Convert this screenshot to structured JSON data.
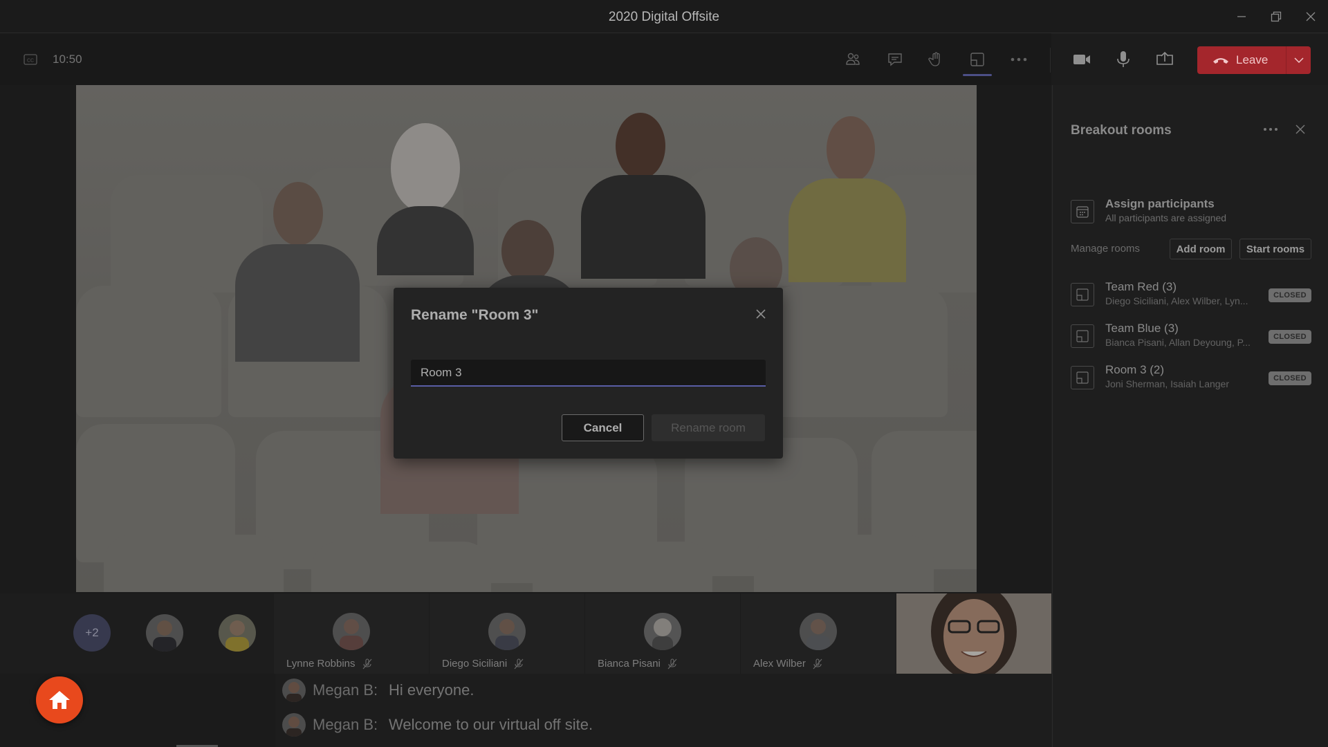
{
  "window": {
    "title": "2020 Digital Offsite"
  },
  "toolbar": {
    "time": "10:50",
    "leave_label": "Leave",
    "colors": {
      "leave": "#a4262c",
      "active_underline": "#6b6fc4"
    }
  },
  "dialog": {
    "title": "Rename \"Room 3\"",
    "input_value": "Room 3",
    "cancel_label": "Cancel",
    "rename_label": "Rename room",
    "accent": "#7f85f5"
  },
  "participants": {
    "overflow_count": "+2",
    "tiles": [
      {
        "name": "Lynne Robbins"
      },
      {
        "name": "Diego Siciliani"
      },
      {
        "name": "Bianca Pisani"
      },
      {
        "name": "Alex Wilber"
      }
    ]
  },
  "captions": [
    {
      "speaker": "Megan B:",
      "text": "Hi everyone."
    },
    {
      "speaker": "Megan B:",
      "text": "Welcome to our virtual off site."
    }
  ],
  "panel": {
    "title": "Breakout rooms",
    "assign_title": "Assign participants",
    "assign_subtitle": "All participants are assigned",
    "manage_label": "Manage rooms",
    "add_room_label": "Add room",
    "start_rooms_label": "Start rooms",
    "rooms": [
      {
        "name": "Team Red (3)",
        "people": "Diego Siciliani, Alex Wilber, Lyn...",
        "status": "CLOSED"
      },
      {
        "name": "Team Blue (3)",
        "people": "Bianca Pisani, Allan Deyoung, P...",
        "status": "CLOSED"
      },
      {
        "name": "Room 3 (2)",
        "people": "Joni Sherman, Isaiah Langer",
        "status": "CLOSED"
      }
    ]
  },
  "home_button": {
    "color": "#e8491d"
  }
}
